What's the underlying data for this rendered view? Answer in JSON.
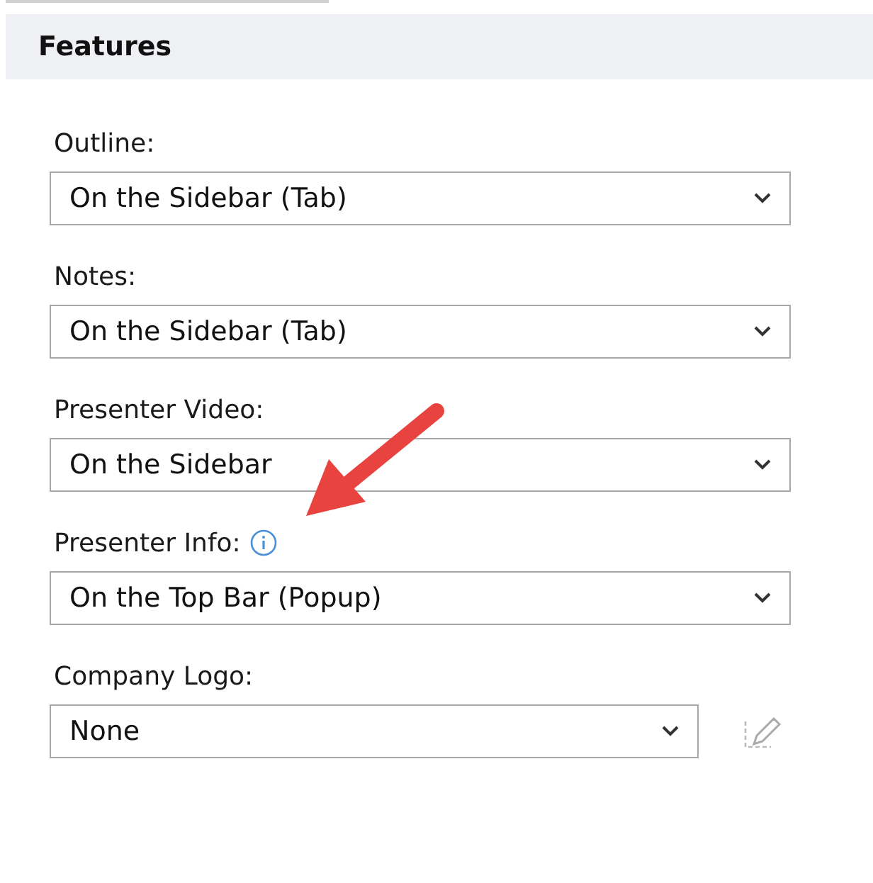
{
  "section": {
    "title": "Features"
  },
  "fields": [
    {
      "label": "Outline:",
      "value": "On the Sidebar (Tab)",
      "info": false,
      "edit_button": false
    },
    {
      "label": "Notes:",
      "value": "On the Sidebar (Tab)",
      "info": false,
      "edit_button": false
    },
    {
      "label": "Presenter Video:",
      "value": "On the Sidebar",
      "info": false,
      "edit_button": false
    },
    {
      "label": "Presenter Info:",
      "value": "On the Top Bar (Popup)",
      "info": true,
      "edit_button": false
    },
    {
      "label": "Company Logo:",
      "value": "None",
      "info": false,
      "edit_button": true
    }
  ]
}
